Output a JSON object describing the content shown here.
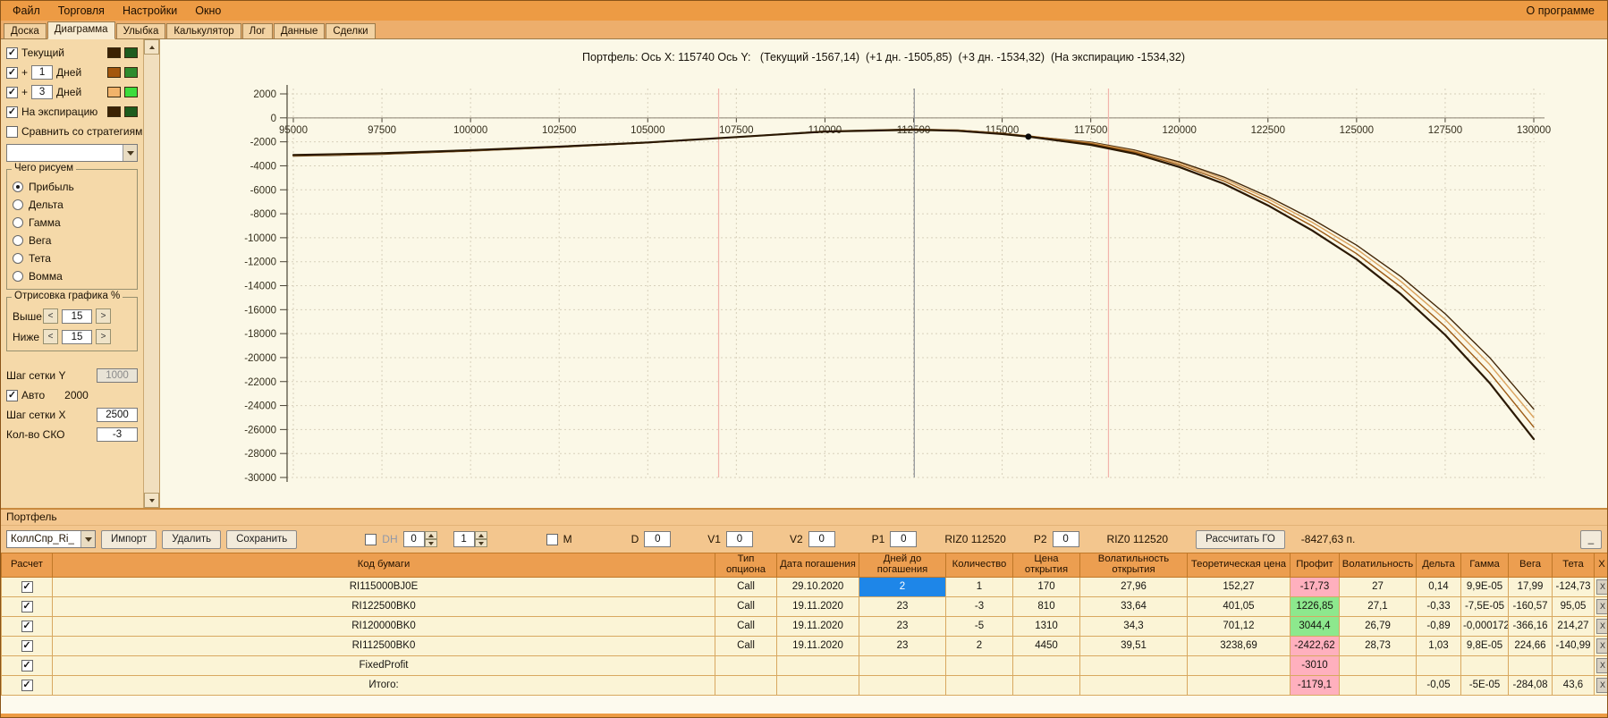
{
  "colors": {
    "chrome_orange": "#ED9B44",
    "window_tan": "#F2BE83",
    "sidebar_tan": "#F5D9A9",
    "chart_cream": "#FBF8E7",
    "toolbar_tan": "#F3C68E",
    "table_header": "#EC9E50",
    "table_row": "#FBF4D6",
    "profit_neg": "#FFB0BE",
    "profit_pos": "#8DE88D",
    "selected_cell": "#1E86E8"
  },
  "menubar": {
    "items": [
      "Файл",
      "Торговля",
      "Настройки",
      "Окно"
    ],
    "right": "О программе"
  },
  "tabs": {
    "items": [
      "Доска",
      "Диаграмма",
      "Улыбка",
      "Калькулятор",
      "Лог",
      "Данные",
      "Сделки"
    ],
    "active": "Диаграмма"
  },
  "sidebar": {
    "current": {
      "label": "Текущий",
      "checked": true,
      "colors": [
        "#3b2203",
        "#1e5c1e"
      ]
    },
    "plus1": {
      "prefix": "+",
      "value": "1",
      "label": "Дней",
      "checked": true,
      "colors": [
        "#a3570e",
        "#2e8b2e"
      ]
    },
    "plus3": {
      "prefix": "+",
      "value": "3",
      "label": "Дней",
      "checked": true,
      "colors": [
        "#f2b36a",
        "#3ddc3d"
      ]
    },
    "expiration": {
      "label": "На экспирацию",
      "checked": true,
      "colors": [
        "#3b2203",
        "#1e5c1e"
      ]
    },
    "compare": {
      "label": "Сравнить со стратегиями",
      "checked": false
    },
    "strategy_select": {
      "value": ""
    },
    "draw_group": {
      "title": "Чего рисуем",
      "options": [
        "Прибыль",
        "Дельта",
        "Гамма",
        "Вега",
        "Тета",
        "Вомма"
      ],
      "selected": "Прибыль"
    },
    "render_group": {
      "title": "Отрисовка графика %",
      "above_label": "Выше",
      "above_value": "15",
      "below_label": "Ниже",
      "below_value": "15",
      "dec_label": "<",
      "inc_label": ">"
    },
    "grid_y_label": "Шаг сетки Y",
    "grid_y_value": "1000",
    "auto_label": "Авто",
    "auto_checked": true,
    "auto_value": "2000",
    "grid_x_label": "Шаг сетки X",
    "grid_x_value": "2500",
    "sko_label": "Кол-во СКО",
    "sko_value": "-3"
  },
  "chart": {
    "title": "Портфель: Ось X: 115740 Ось Y:   (Текущий -1567,14)  (+1 дн. -1505,85)  (+3 дн. -1534,32)  (На экспирацию -1534,32)"
  },
  "chart_data": {
    "type": "line",
    "title": "Портфель: Ось X: 115740 Ось Y: (Текущий -1567,14) (+1 дн. -1505,85) (+3 дн. -1534,32) (На экспирацию -1534,32)",
    "xlabel": "",
    "ylabel": "",
    "xlim": [
      95000,
      130000
    ],
    "ylim": [
      -30000,
      2000
    ],
    "grid": true,
    "x_ticks": [
      95000,
      97500,
      100000,
      102500,
      105000,
      107500,
      110000,
      112500,
      115000,
      117500,
      120000,
      122500,
      125000,
      127500,
      130000
    ],
    "y_ticks": [
      2000,
      0,
      -2000,
      -4000,
      -6000,
      -8000,
      -10000,
      -12000,
      -14000,
      -16000,
      -18000,
      -20000,
      -22000,
      -24000,
      -26000,
      -28000,
      -30000
    ],
    "x": [
      95000,
      97500,
      100000,
      102500,
      105000,
      107500,
      110000,
      112500,
      113750,
      115000,
      115740,
      117500,
      118750,
      120000,
      121250,
      122500,
      123750,
      125000,
      126250,
      127500,
      128750,
      130000
    ],
    "series": [
      {
        "name": "Текущий",
        "color": "#2a1802",
        "width": 2.2,
        "values": [
          -3100,
          -2950,
          -2700,
          -2400,
          -2050,
          -1600,
          -1150,
          -1000,
          -1080,
          -1350,
          -1567,
          -2250,
          -3000,
          -4100,
          -5500,
          -7300,
          -9400,
          -11800,
          -14700,
          -18100,
          -22100,
          -26800
        ]
      },
      {
        "name": "+1 Дней",
        "color": "#9c5a14",
        "width": 1.4,
        "values": [
          -3130,
          -2980,
          -2730,
          -2420,
          -2060,
          -1610,
          -1140,
          -980,
          -1050,
          -1300,
          -1506,
          -2150,
          -2870,
          -3920,
          -5260,
          -7000,
          -9020,
          -11330,
          -14120,
          -17400,
          -21250,
          -25800
        ]
      },
      {
        "name": "+3 Дней",
        "color": "#dba35e",
        "width": 1.4,
        "values": [
          -3160,
          -3010,
          -2750,
          -2440,
          -2070,
          -1610,
          -1130,
          -960,
          -1030,
          -1290,
          -1534,
          -2080,
          -2780,
          -3790,
          -5080,
          -6760,
          -8710,
          -10940,
          -13640,
          -16820,
          -20560,
          -25000
        ]
      },
      {
        "name": "На экспирацию",
        "color": "#45290a",
        "width": 1.4,
        "values": [
          -3190,
          -3040,
          -2770,
          -2450,
          -2080,
          -1600,
          -1110,
          -940,
          -1010,
          -1280,
          -1534,
          -2020,
          -2700,
          -3680,
          -4930,
          -6560,
          -8450,
          -10620,
          -13240,
          -16340,
          -19980,
          -24300
        ]
      }
    ],
    "marker": {
      "x": 115740,
      "y": -1567,
      "color": "#0a0a0a"
    },
    "vlines": [
      {
        "x": 112520,
        "color": "#8d9096"
      },
      {
        "x": 107000,
        "color": "#f2b3ab"
      },
      {
        "x": 118000,
        "color": "#f2b3ab"
      }
    ]
  },
  "portfolio": {
    "section_label": "Портфель",
    "combo_value": "КоллСпр_Ri_",
    "buttons": {
      "import": "Импорт",
      "delete": "Удалить",
      "save": "Сохранить",
      "calc_go": "Рассчитать ГО"
    },
    "dh_label": "DH",
    "dh_checked": false,
    "dh_spin1": "0",
    "dh_spin2": "1",
    "m_label": "М",
    "m_checked": false,
    "d_label": "D",
    "d_value": "0",
    "v1_label": "V1",
    "v1_value": "0",
    "v2_label": "V2",
    "v2_value": "0",
    "p1_label": "P1",
    "p1_value": "0",
    "ticker1": "RIZ0 112520",
    "p2_label": "P2",
    "p2_value": "0",
    "ticker2": "RIZ0 112520",
    "go_value": "-8427,63 п.",
    "corner_button": "_"
  },
  "table": {
    "headers": [
      "Расчет",
      "Код бумаги",
      "Тип опциона",
      "Дата погашения",
      "Дней до погашения",
      "Количество",
      "Цена открытия",
      "Волатильность открытия",
      "Теоретическая цена",
      "Профит",
      "Волатильность",
      "Дельта",
      "Гамма",
      "Вега",
      "Тета",
      "X"
    ],
    "delete_label": "X",
    "rows": [
      {
        "checked": true,
        "code": "RI115000BJ0E",
        "type": "Call",
        "date": "29.10.2020",
        "days": "2",
        "days_selected": true,
        "qty": "1",
        "open_price": "170",
        "open_vol": "27,96",
        "theor_price": "152,27",
        "profit": "-17,73",
        "vol": "27",
        "delta": "0,14",
        "gamma": "9,9E-05",
        "vega": "17,99",
        "theta": "-124,73"
      },
      {
        "checked": true,
        "code": "RI122500BK0",
        "type": "Call",
        "date": "19.11.2020",
        "days": "23",
        "qty": "-3",
        "open_price": "810",
        "open_vol": "33,64",
        "theor_price": "401,05",
        "profit": "1226,85",
        "vol": "27,1",
        "delta": "-0,33",
        "gamma": "-7,5E-05",
        "vega": "-160,57",
        "theta": "95,05"
      },
      {
        "checked": true,
        "code": "RI120000BK0",
        "type": "Call",
        "date": "19.11.2020",
        "days": "23",
        "qty": "-5",
        "open_price": "1310",
        "open_vol": "34,3",
        "theor_price": "701,12",
        "profit": "3044,4",
        "vol": "26,79",
        "delta": "-0,89",
        "gamma": "-0,000172",
        "vega": "-366,16",
        "theta": "214,27"
      },
      {
        "checked": true,
        "code": "RI112500BK0",
        "type": "Call",
        "date": "19.11.2020",
        "days": "23",
        "qty": "2",
        "open_price": "4450",
        "open_vol": "39,51",
        "theor_price": "3238,69",
        "profit": "-2422,62",
        "vol": "28,73",
        "delta": "1,03",
        "gamma": "9,8E-05",
        "vega": "224,66",
        "theta": "-140,99"
      },
      {
        "checked": true,
        "code": "FixedProfit",
        "profit": "-3010"
      },
      {
        "checked": true,
        "code": "Итого:",
        "profit": "-1179,1",
        "delta": "-0,05",
        "gamma": "-5E-05",
        "vega": "-284,08",
        "theta": "43,6"
      }
    ]
  }
}
